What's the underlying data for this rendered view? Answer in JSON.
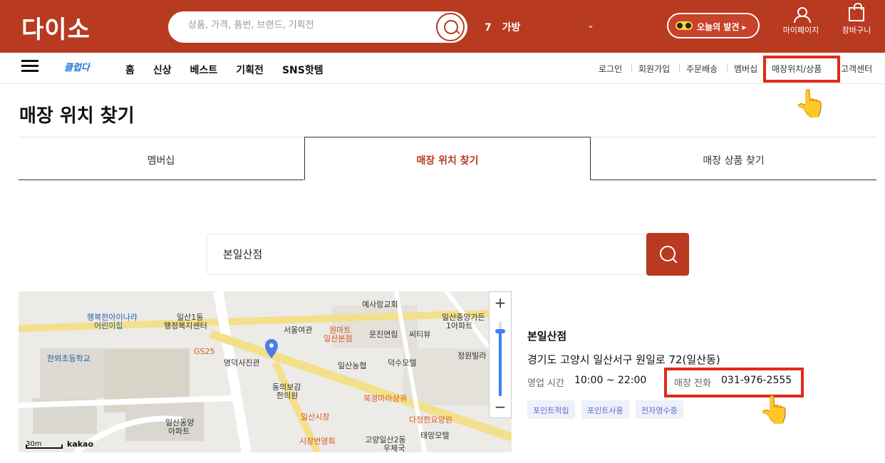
{
  "header": {
    "logo": "다이소",
    "search_placeholder": "상품, 가격, 품번, 브랜드, 기획전",
    "trend_rank": "7",
    "trend_keyword": "가방",
    "today_label": "오늘의 발견 ▸",
    "mypage_label": "마이페이지",
    "cart_label": "장바구니"
  },
  "nav": {
    "club_logo": "클럽다",
    "menu": [
      "홈",
      "신상",
      "베스트",
      "기획전",
      "SNS핫템"
    ],
    "util": [
      "로그인",
      "회원가입",
      "주문배송",
      "멤버십",
      "매장위치/상품",
      "고객센터"
    ]
  },
  "page": {
    "title": "매장 위치 찾기",
    "tabs": [
      "멤버십",
      "매장 위치 찾기",
      "매장 상품 찾기"
    ],
    "active_tab": 1
  },
  "store_search": {
    "value": "본일산점"
  },
  "map": {
    "provider": "kakao",
    "scale_label": "30m",
    "labels": [
      "행복한아이나라",
      "어린이집",
      "일산1동",
      "행정복지센터",
      "예사랑교회",
      "서울여관",
      "원마트",
      "일산본점",
      "운진연립",
      "씨티뷰",
      "일산중앙가든",
      "1아파트",
      "한뫼초등학교",
      "GS25",
      "명덕사진관",
      "일산농협",
      "덕수모텔",
      "정원빌라",
      "동의보감",
      "한의원",
      "북경마라샹궈",
      "일산시장",
      "다정한요양원",
      "일산동양",
      "아파트",
      "시장번영회",
      "고양일산2동",
      "우체국",
      "태앙모텔"
    ]
  },
  "store": {
    "name": "본일산점",
    "address": "경기도 고양시 일산서구 원일로 72(일산동)",
    "hours_label": "영업 시간",
    "hours": "10:00 ~ 22:00",
    "phone_label": "매장 전화",
    "phone": "031-976-2555",
    "badges": [
      "포인트적립",
      "포인트사용",
      "전자영수증"
    ]
  },
  "colors": {
    "brand": "#b83a20",
    "highlight": "#e02a1a",
    "badge_bg": "#eef0fb"
  }
}
